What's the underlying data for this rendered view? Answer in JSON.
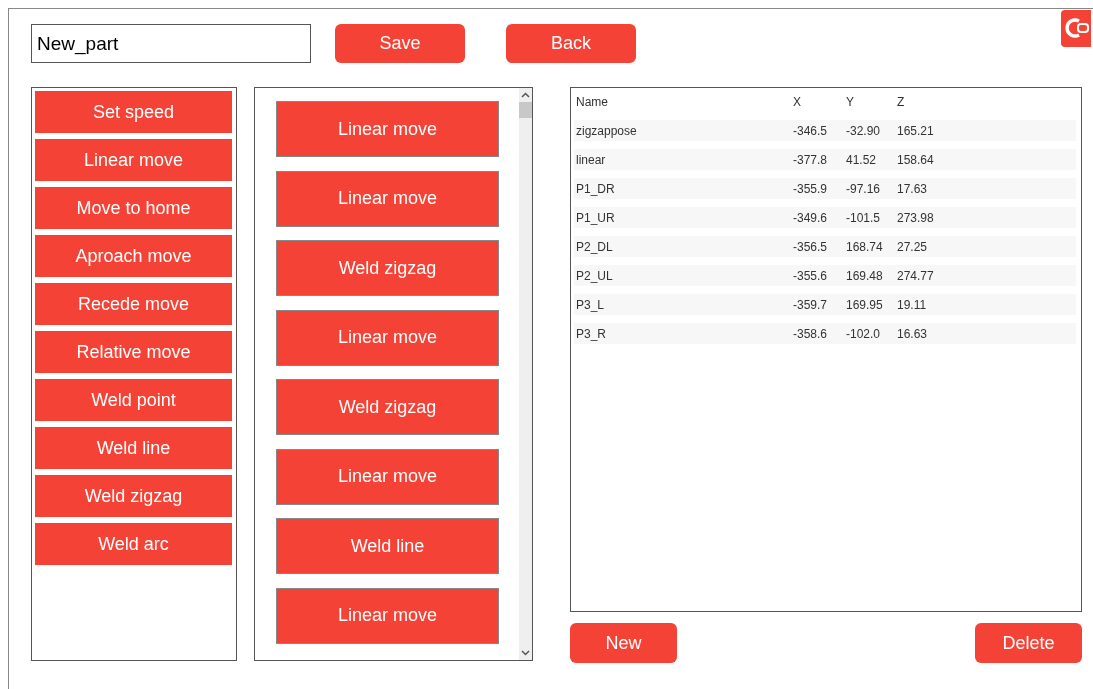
{
  "name_field": {
    "value": "New_part"
  },
  "top_buttons": [
    "Save",
    "Back"
  ],
  "commands": [
    "Set speed",
    "Linear move",
    "Move to home",
    "Aproach move",
    "Recede move",
    "Relative move",
    "Weld point",
    "Weld line",
    "Weld zigzag",
    "Weld arc"
  ],
  "program_steps": [
    "Linear move",
    "Linear move",
    "Weld zigzag",
    "Linear move",
    "Weld zigzag",
    "Linear move",
    "Weld line",
    "Linear move"
  ],
  "points_table": {
    "columns": [
      "Name",
      "X",
      "Y",
      "Z"
    ],
    "rows": [
      [
        "zigzappose",
        "-346.5",
        "-32.90",
        "165.21"
      ],
      [
        "linear",
        "-377.8",
        "41.52",
        "158.64"
      ],
      [
        "P1_DR",
        "-355.9",
        "-97.16",
        "17.63"
      ],
      [
        "P1_UR",
        "-349.6",
        "-101.5",
        "273.98"
      ],
      [
        "P2_DL",
        "-356.5",
        "168.74",
        "27.25"
      ],
      [
        "P2_UL",
        "-355.6",
        "169.48",
        "274.77"
      ],
      [
        "P3_L",
        "-359.7",
        "169.95",
        "19.11"
      ],
      [
        "P3_R",
        "-358.6",
        "-102.0",
        "16.63"
      ]
    ]
  },
  "bottom_buttons": [
    "New",
    "Delete"
  ]
}
